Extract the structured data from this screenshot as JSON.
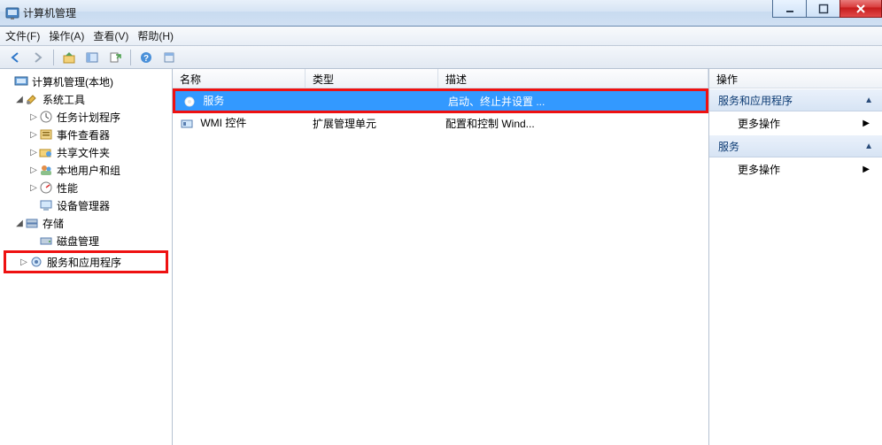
{
  "window": {
    "title": "计算机管理"
  },
  "menu": {
    "file": "文件(F)",
    "action": "操作(A)",
    "view": "查看(V)",
    "help": "帮助(H)"
  },
  "tree": {
    "root": "计算机管理(本地)",
    "n1": "系统工具",
    "n1a": "任务计划程序",
    "n1b": "事件查看器",
    "n1c": "共享文件夹",
    "n1d": "本地用户和组",
    "n1e": "性能",
    "n1f": "设备管理器",
    "n2": "存储",
    "n2a": "磁盘管理",
    "n3": "服务和应用程序"
  },
  "list": {
    "head_name": "名称",
    "head_type": "类型",
    "head_desc": "描述",
    "rows": [
      {
        "name": "服务",
        "type": "",
        "desc": "启动、终止并设置 ..."
      },
      {
        "name": "WMI 控件",
        "type": "扩展管理单元",
        "desc": "配置和控制 Wind..."
      }
    ]
  },
  "actions": {
    "header": "操作",
    "group1": "服务和应用程序",
    "item1": "更多操作",
    "group2": "服务",
    "item2": "更多操作"
  }
}
